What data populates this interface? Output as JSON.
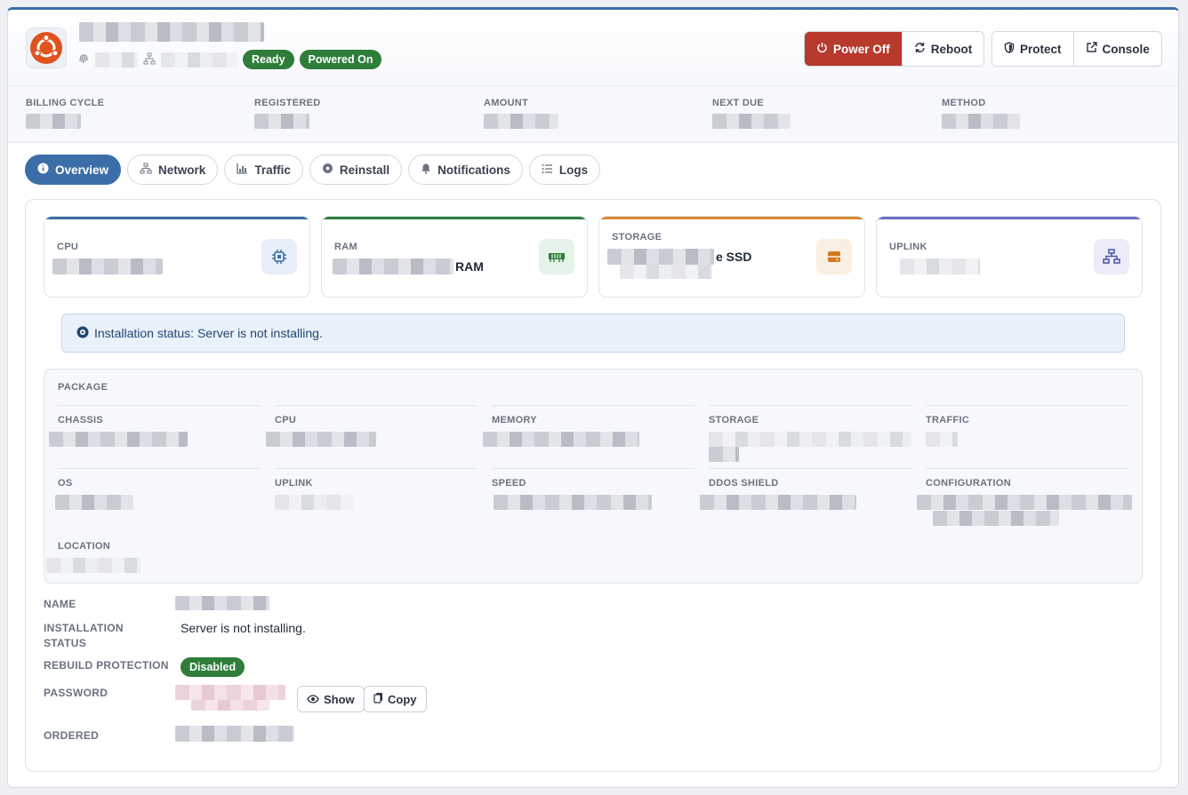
{
  "header": {
    "status_badges": [
      "Ready",
      "Powered On"
    ],
    "actions": {
      "power_off": "Power Off",
      "reboot": "Reboot",
      "protect": "Protect",
      "console": "Console"
    }
  },
  "billing": {
    "labels": [
      "BILLING CYCLE",
      "REGISTERED",
      "AMOUNT",
      "NEXT DUE",
      "METHOD"
    ]
  },
  "tabs": [
    "Overview",
    "Network",
    "Traffic",
    "Reinstall",
    "Notifications",
    "Logs"
  ],
  "stats": {
    "cpu": {
      "label": "CPU"
    },
    "ram": {
      "label": "RAM",
      "suffix": "RAM"
    },
    "storage": {
      "label": "STORAGE",
      "suffix": "e SSD"
    },
    "uplink": {
      "label": "UPLINK"
    }
  },
  "alert": {
    "text": "Installation status: Server is not installing."
  },
  "package": {
    "title": "PACKAGE",
    "labels": [
      "CHASSIS",
      "CPU",
      "MEMORY",
      "STORAGE",
      "TRAFFIC",
      "OS",
      "UPLINK",
      "SPEED",
      "DDOS SHIELD",
      "CONFIGURATION",
      "LOCATION"
    ]
  },
  "details": {
    "name_label": "NAME",
    "install_label": "INSTALLATION STATUS",
    "install_value": "Server is not installing.",
    "rebuild_label": "REBUILD PROTECTION",
    "rebuild_value": "Disabled",
    "password_label": "PASSWORD",
    "show_label": "Show",
    "copy_label": "Copy",
    "ordered_label": "ORDERED"
  },
  "colors": {
    "accent": "#3b6ea8",
    "danger": "#b73a2d",
    "success": "#2e7d3a",
    "cpu_bar": "#3b6ea8",
    "ram_bar": "#2e7d3a",
    "storage_bar": "#d9892f",
    "uplink_bar": "#6a6fc4"
  }
}
